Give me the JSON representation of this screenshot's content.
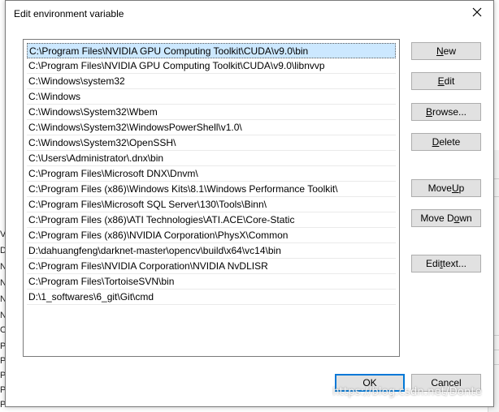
{
  "dialog": {
    "title": "Edit environment variable"
  },
  "entries": [
    "C:\\Program Files\\NVIDIA GPU Computing Toolkit\\CUDA\\v9.0\\bin",
    "C:\\Program Files\\NVIDIA GPU Computing Toolkit\\CUDA\\v9.0\\libnvvp",
    "C:\\Windows\\system32",
    "C:\\Windows",
    "C:\\Windows\\System32\\Wbem",
    "C:\\Windows\\System32\\WindowsPowerShell\\v1.0\\",
    "C:\\Windows\\System32\\OpenSSH\\",
    "C:\\Users\\Administrator\\.dnx\\bin",
    "C:\\Program Files\\Microsoft DNX\\Dnvm\\",
    "C:\\Program Files (x86)\\Windows Kits\\8.1\\Windows Performance Toolkit\\",
    "C:\\Program Files\\Microsoft SQL Server\\130\\Tools\\Binn\\",
    "C:\\Program Files (x86)\\ATI Technologies\\ATI.ACE\\Core-Static",
    "C:\\Program Files (x86)\\NVIDIA Corporation\\PhysX\\Common",
    "D:\\dahuangfeng\\darknet-master\\opencv\\build\\x64\\vc14\\bin",
    "C:\\Program Files\\NVIDIA Corporation\\NVIDIA NvDLISR",
    "C:\\Program Files\\TortoiseSVN\\bin",
    "D:\\1_softwares\\6_git\\Git\\cmd"
  ],
  "selected_index": 0,
  "buttons": {
    "new": {
      "pre": "",
      "accel": "N",
      "post": "ew"
    },
    "edit": {
      "pre": "",
      "accel": "E",
      "post": "dit"
    },
    "browse": {
      "pre": "",
      "accel": "B",
      "post": "rowse..."
    },
    "delete": {
      "pre": "",
      "accel": "D",
      "post": "elete"
    },
    "move_up": {
      "pre": "Move ",
      "accel": "U",
      "post": "p"
    },
    "move_down": {
      "pre": "Move D",
      "accel": "o",
      "post": "wn"
    },
    "edit_text": {
      "pre": "Edi",
      "accel": "t",
      "post": " text..."
    },
    "ok": "OK",
    "cancel": "Cancel"
  },
  "background": {
    "left_fragments": [
      "Va",
      "Dr",
      "N",
      "N",
      "N",
      "N",
      "O",
      "Pa",
      "PA",
      "PR",
      "PR",
      "PR"
    ]
  },
  "watermark": "https://blog.csdn.net/Donte",
  "colors": {
    "selection": "#cce8ff",
    "accent": "#0078d7",
    "button_face": "#e1e1e1"
  }
}
